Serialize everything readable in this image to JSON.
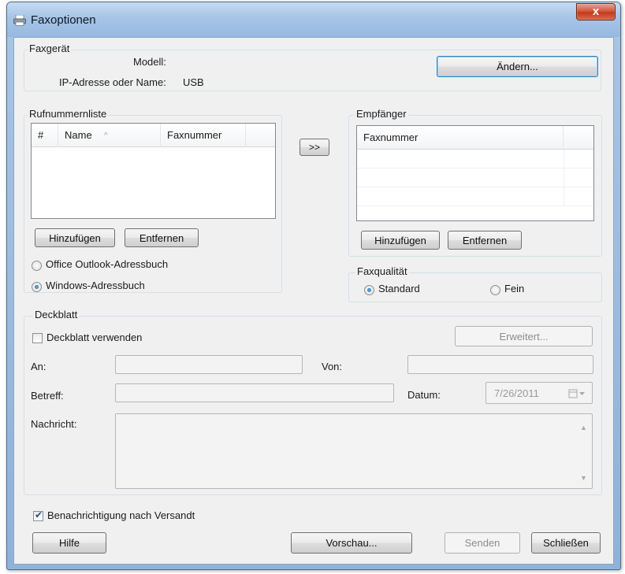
{
  "window": {
    "title": "Faxoptionen",
    "close_label": "x"
  },
  "fax_device": {
    "group_label": "Faxgerät",
    "model_label": "Modell:",
    "model_value": "",
    "ip_label": "IP-Adresse oder Name:",
    "ip_value": "USB",
    "change_button": "Ändern..."
  },
  "phonebook": {
    "group_label": "Rufnummernliste",
    "columns": [
      "#",
      "Name",
      "Faxnummer"
    ],
    "sort_indicator": "^",
    "add_button": "Hinzufügen",
    "remove_button": "Entfernen",
    "options": [
      "Office Outlook-Adressbuch",
      "Windows-Adressbuch"
    ],
    "selected_option": "Windows-Adressbuch"
  },
  "transfer_button": ">>",
  "recipients": {
    "group_label": "Empfänger",
    "columns": [
      "Faxnummer"
    ],
    "add_button": "Hinzufügen",
    "remove_button": "Entfernen"
  },
  "fax_quality": {
    "group_label": "Faxqualität",
    "options": [
      "Standard",
      "Fein"
    ],
    "selected": "Standard"
  },
  "cover_sheet": {
    "group_label": "Deckblatt",
    "use_checkbox_label": "Deckblatt verwenden",
    "use_checked": false,
    "advanced_button": "Erweitert...",
    "to_label": "An:",
    "to_value": "",
    "from_label": "Von:",
    "from_value": "",
    "subject_label": "Betreff:",
    "subject_value": "",
    "date_label": "Datum:",
    "date_value": "7/26/2011",
    "message_label": "Nachricht:",
    "message_value": ""
  },
  "notify_checkbox_label": "Benachrichtigung nach Versandt",
  "notify_checked": true,
  "buttons": {
    "help": "Hilfe",
    "preview": "Vorschau...",
    "send": "Senden",
    "close": "Schließen"
  },
  "colors": {
    "title_gradient_top": "#c5dbf2",
    "client_bg": "#f0f0f0",
    "close_button": "#c33a1b"
  }
}
